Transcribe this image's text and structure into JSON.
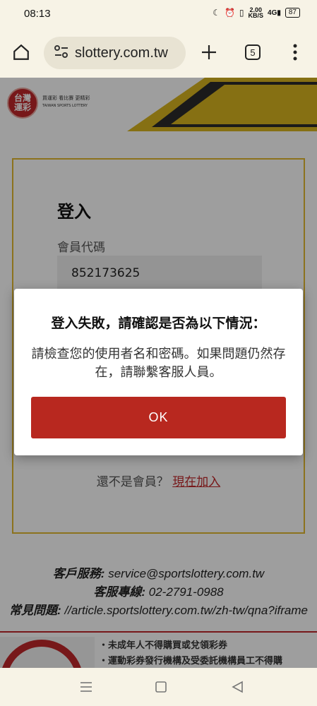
{
  "status_bar": {
    "time": "08:13",
    "speed_value": "2.00",
    "speed_unit": "KB/S",
    "network": "4G",
    "battery": "87"
  },
  "browser": {
    "url": "slottery.com.tw",
    "tab_count": "5"
  },
  "site": {
    "logo_text": "台灣\n運彩",
    "tagline_cn": "買運彩  看比賽  更精彩",
    "tagline_en": "TAIWAN SPORTS LOTTERY"
  },
  "login": {
    "title": "登入",
    "member_label": "會員代碼",
    "member_value": "852173625",
    "register_prompt": "還不是會員？",
    "register_link": "現在加入"
  },
  "contact": {
    "service_label": "客戶服務:",
    "service_value": "service@sportslottery.com.tw",
    "hotline_label": "客服專線:",
    "hotline_value": "02-2791-0988",
    "faq_label": "常見問題:",
    "faq_value": "//article.sportslottery.com.tw/zh-tw/qna?iframe"
  },
  "footer": {
    "line1": "・未成年人不得購買或兌領彩券",
    "line2": "・運動彩券發行機構及受委託機構員工不得購"
  },
  "dialog": {
    "title": "登入失敗，請確認是否為以下情況：",
    "message": "請檢查您的使用者名和密碼。如果問題仍然存在，請聯繫客服人員。",
    "ok_label": "OK"
  },
  "colors": {
    "brand_red": "#c0282a",
    "ok_red": "#b8281f",
    "card_border": "#e3b92f",
    "stripe_yellow": "#d8b51f"
  }
}
